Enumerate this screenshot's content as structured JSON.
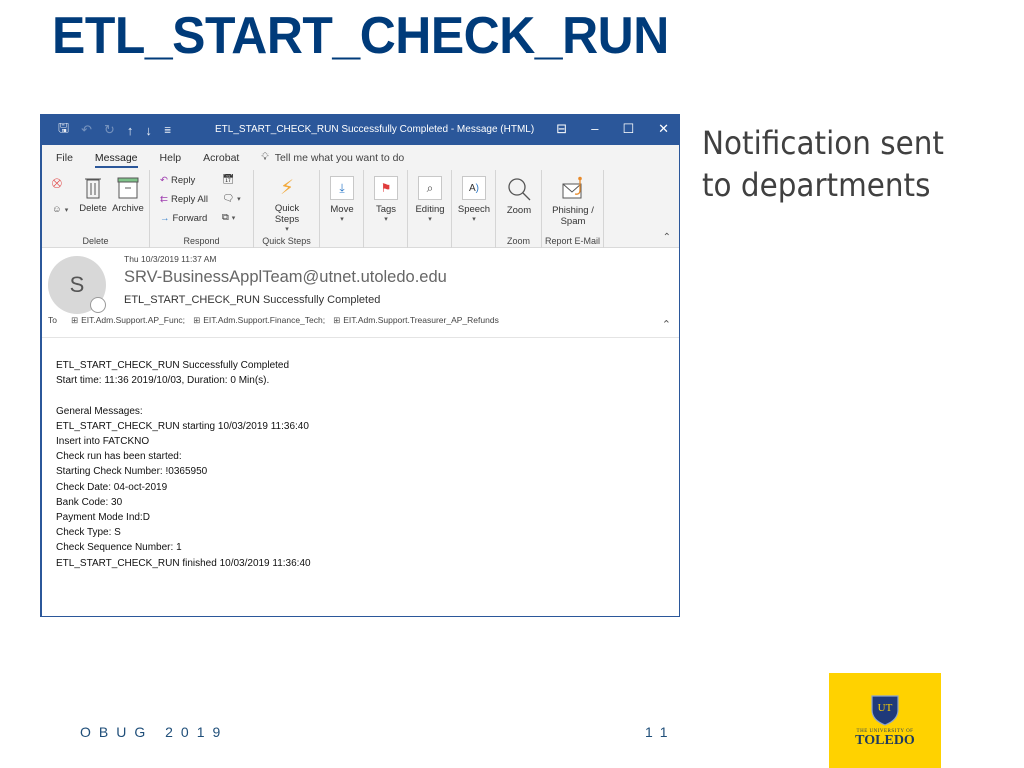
{
  "slide": {
    "title": "ETL_START_CHECK_RUN",
    "side_note": "Notification sent to departments",
    "footer_left": "OBUG 2019",
    "page_number": "11",
    "logo": {
      "small_text": "THE UNIVERSITY OF",
      "big_text": "TOLEDO",
      "shield_text": "UT",
      "bg_color": "#ffd200"
    }
  },
  "window": {
    "title": "ETL_START_CHECK_RUN Successfully Completed  -  Message (HTML)",
    "accent_color": "#2b579a",
    "qat": [
      "save-icon",
      "undo-icon",
      "redo-icon",
      "up-arrow-icon",
      "down-arrow-icon",
      "customize-icon"
    ],
    "menu": [
      {
        "label": "File"
      },
      {
        "label": "Message",
        "active": true
      },
      {
        "label": "Help"
      },
      {
        "label": "Acrobat"
      }
    ],
    "tell_me": "Tell me what you want to do",
    "ribbon": {
      "delete_group": {
        "label": "Delete",
        "delete": "Delete",
        "archive": "Archive"
      },
      "respond_group": {
        "label": "Respond",
        "reply": "Reply",
        "reply_all": "Reply All",
        "forward": "Forward"
      },
      "quick_steps_group": {
        "label": "Quick Steps",
        "quick_steps": "Quick Steps"
      },
      "move": "Move",
      "tags": "Tags",
      "editing": "Editing",
      "speech": "Speech",
      "zoom_group": {
        "label": "Zoom",
        "zoom": "Zoom"
      },
      "report_group": {
        "label": "Report E-Mail",
        "phishing": "Phishing / Spam"
      }
    }
  },
  "email": {
    "avatar_initial": "S",
    "date": "Thu 10/3/2019 11:37 AM",
    "from": "SRV-BusinessApplTeam@utnet.utoledo.edu",
    "subject": "ETL_START_CHECK_RUN Successfully Completed",
    "to_label": "To",
    "recipients": [
      "EIT.Adm.Support.AP_Func;",
      "EIT.Adm.Support.Finance_Tech;",
      "EIT.Adm.Support.Treasurer_AP_Refunds"
    ],
    "body_lines": [
      "ETL_START_CHECK_RUN Successfully Completed",
      "Start time: 11:36 2019/10/03, Duration: 0 Min(s).",
      "",
      "General Messages:",
      "ETL_START_CHECK_RUN starting 10/03/2019 11:36:40",
      "Insert into FATCKNO",
      "Check run has been started:",
      "Starting Check Number: !0365950",
      "Check Date: 04-oct-2019",
      "Bank Code: 30",
      "Payment Mode Ind:D",
      "Check Type: S",
      "Check Sequence Number: 1",
      "ETL_START_CHECK_RUN finished 10/03/2019 11:36:40"
    ]
  }
}
